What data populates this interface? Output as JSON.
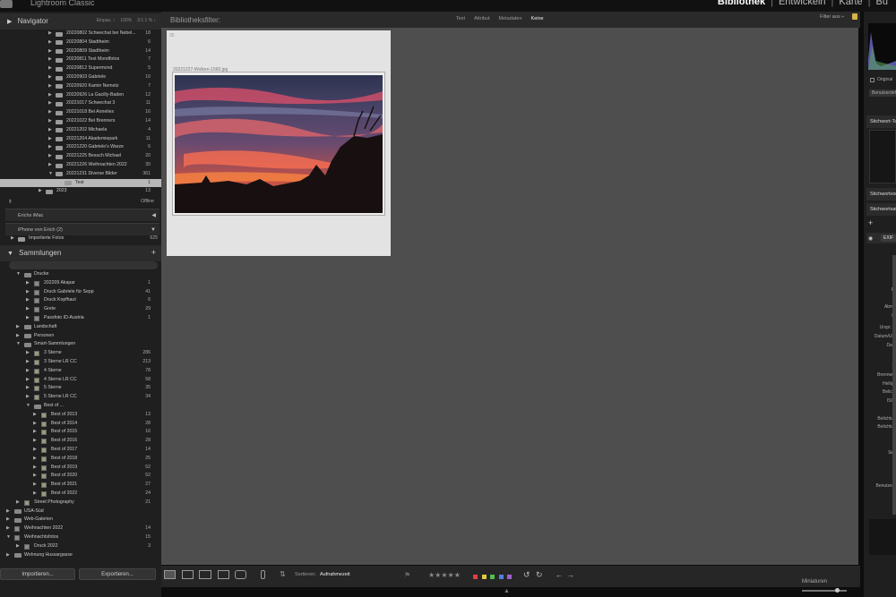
{
  "app": {
    "title": "Lightroom Classic"
  },
  "modules": {
    "items": [
      "Bibliothek",
      "|",
      "Entwickeln",
      "|",
      "Karte",
      "|",
      "Bu"
    ]
  },
  "navigator": {
    "title": "Navigator",
    "zoom": [
      "Einpas. ↕",
      "100%",
      "3:1:1 % ↕"
    ]
  },
  "folders": [
    {
      "label": "20220802 Schwechat bei Nebel...",
      "count": "18",
      "indent": 54,
      "tri": "▶"
    },
    {
      "label": "20220804 Stadtheim",
      "count": "6",
      "indent": 54,
      "tri": "▶"
    },
    {
      "label": "20220809 Stadtheim",
      "count": "14",
      "indent": 54,
      "tri": "▶"
    },
    {
      "label": "20220811 Test Mondfotos",
      "count": "7",
      "indent": 54,
      "tri": "▶"
    },
    {
      "label": "20220812 Supermond",
      "count": "5",
      "indent": 54,
      "tri": "▶"
    },
    {
      "label": "20220903 Gabriele",
      "count": "10",
      "indent": 54,
      "tri": "▶"
    },
    {
      "label": "20220920 Kamin Nemetz",
      "count": "7",
      "indent": 54,
      "tri": "▶"
    },
    {
      "label": "20220926 La Gacilly-Baden",
      "count": "12",
      "indent": 54,
      "tri": "▶"
    },
    {
      "label": "20221017 Schwechat 3",
      "count": "11",
      "indent": 54,
      "tri": "▶"
    },
    {
      "label": "20221018 Bei Annelies",
      "count": "16",
      "indent": 54,
      "tri": "▶"
    },
    {
      "label": "20221022 Bei Brenners",
      "count": "14",
      "indent": 54,
      "tri": "▶"
    },
    {
      "label": "20221202 Michaela",
      "count": "4",
      "indent": 54,
      "tri": "▶"
    },
    {
      "label": "20221204 Akademiepark",
      "count": "11",
      "indent": 54,
      "tri": "▶"
    },
    {
      "label": "20221220 Gabriele's Warze",
      "count": "6",
      "indent": 54,
      "tri": "▶"
    },
    {
      "label": "20221225 Besuch Michael",
      "count": "20",
      "indent": 54,
      "tri": "▶"
    },
    {
      "label": "20221226 Weihnachten 2022",
      "count": "30",
      "indent": 54,
      "tri": "▶"
    },
    {
      "label": "20221231 Diverse Bilder",
      "count": "361",
      "indent": 54,
      "tri": "▼"
    },
    {
      "label": "Test",
      "count": "1",
      "indent": 64,
      "tri": "",
      "selected": true
    },
    {
      "label": "2023",
      "count": "13",
      "indent": 43,
      "tri": "▶"
    }
  ],
  "sources": {
    "offline_label": "Offline",
    "erichs_imac": "Erichs iMac",
    "iphone": "iPhone von Erich (2)",
    "imported": {
      "label": "Importierte Fotos",
      "count": "625"
    }
  },
  "collections": {
    "title": "Sammlungen",
    "items": [
      {
        "label": "Drucke",
        "count": "",
        "indent": 18,
        "tri": "▼",
        "type": "set"
      },
      {
        "label": "202209 Akapar",
        "count": "1",
        "indent": 29,
        "tri": "▶",
        "type": "coll"
      },
      {
        "label": "Druck Gabriele für Sepp",
        "count": "41",
        "indent": 29,
        "tri": "▶",
        "type": "coll"
      },
      {
        "label": "Druck Kopfhaut",
        "count": "6",
        "indent": 29,
        "tri": "▶",
        "type": "coll"
      },
      {
        "label": "Grete",
        "count": "29",
        "indent": 29,
        "tri": "▶",
        "type": "coll"
      },
      {
        "label": "Passfoto ID-Austria",
        "count": "1",
        "indent": 29,
        "tri": "▶",
        "type": "coll"
      },
      {
        "label": "Landschaft",
        "count": "",
        "indent": 18,
        "tri": "▶",
        "type": "set"
      },
      {
        "label": "Personen",
        "count": "",
        "indent": 18,
        "tri": "▶",
        "type": "set"
      },
      {
        "label": "Smart-Sammlungen",
        "count": "",
        "indent": 18,
        "tri": "▼",
        "type": "set"
      },
      {
        "label": "3 Sterne",
        "count": "286",
        "indent": 29,
        "tri": "▶",
        "type": "smart"
      },
      {
        "label": "3 Sterne LR CC",
        "count": "213",
        "indent": 29,
        "tri": "▶",
        "type": "smart"
      },
      {
        "label": "4 Sterne",
        "count": "78",
        "indent": 29,
        "tri": "▶",
        "type": "smart"
      },
      {
        "label": "4 Sterne LR CC",
        "count": "58",
        "indent": 29,
        "tri": "▶",
        "type": "smart"
      },
      {
        "label": "5 Sterne",
        "count": "35",
        "indent": 29,
        "tri": "▶",
        "type": "smart"
      },
      {
        "label": "5 Sterne LR CC",
        "count": "34",
        "indent": 29,
        "tri": "▶",
        "type": "smart"
      },
      {
        "label": "Best of ...",
        "count": "",
        "indent": 29,
        "tri": "▼",
        "type": "set"
      },
      {
        "label": "Best of 2013",
        "count": "13",
        "indent": 37,
        "tri": "▶",
        "type": "smart"
      },
      {
        "label": "Best of 2014",
        "count": "28",
        "indent": 37,
        "tri": "▶",
        "type": "smart"
      },
      {
        "label": "Best of 2015",
        "count": "16",
        "indent": 37,
        "tri": "▶",
        "type": "smart"
      },
      {
        "label": "Best of 2016",
        "count": "28",
        "indent": 37,
        "tri": "▶",
        "type": "smart"
      },
      {
        "label": "Best of 2017",
        "count": "14",
        "indent": 37,
        "tri": "▶",
        "type": "smart"
      },
      {
        "label": "Best of 2018",
        "count": "25",
        "indent": 37,
        "tri": "▶",
        "type": "smart"
      },
      {
        "label": "Best of 2019",
        "count": "52",
        "indent": 37,
        "tri": "▶",
        "type": "smart"
      },
      {
        "label": "Best of 2020",
        "count": "52",
        "indent": 37,
        "tri": "▶",
        "type": "smart"
      },
      {
        "label": "Best of 2021",
        "count": "27",
        "indent": 37,
        "tri": "▶",
        "type": "smart"
      },
      {
        "label": "Best of 2022",
        "count": "24",
        "indent": 37,
        "tri": "▶",
        "type": "smart"
      },
      {
        "label": "Street Photography",
        "count": "21",
        "indent": 18,
        "tri": "▶",
        "type": "smart"
      },
      {
        "label": "USA-Süd",
        "count": "",
        "indent": 7,
        "tri": "▶",
        "type": "set"
      },
      {
        "label": "Web-Galerien",
        "count": "",
        "indent": 7,
        "tri": "▶",
        "type": "set"
      },
      {
        "label": "Weihnachten 2022",
        "count": "14",
        "indent": 7,
        "tri": "▶",
        "type": "coll"
      },
      {
        "label": "Weihnachtsfotos",
        "count": "15",
        "indent": 7,
        "tri": "▼",
        "type": "coll"
      },
      {
        "label": "Druck 2022",
        "count": "3",
        "indent": 18,
        "tri": "▶",
        "type": "coll"
      },
      {
        "label": "Wohnung Hussargasse",
        "count": "",
        "indent": 7,
        "tri": "▶",
        "type": "set"
      }
    ]
  },
  "buttons": {
    "import": "Importieren...",
    "export": "Exportieren..."
  },
  "filter": {
    "label": "Bibliotheksfilter:",
    "options": [
      "Text",
      "Attribut",
      "Metadaten",
      "Keine"
    ],
    "active": "Keine",
    "off": "Filter aus ÷"
  },
  "thumbnail": {
    "index": "35",
    "filename": "20221227-Wolken-1560.jpg"
  },
  "toolbar": {
    "sort_label": "Sortieren:",
    "sort_value": "Aufnahmezeit",
    "stars": "★★★★★",
    "colors": [
      "#e04040",
      "#e0c840",
      "#50c050",
      "#5080e0",
      "#a060d0"
    ],
    "thumb_label": "Miniaturen"
  },
  "right_panel": {
    "original": "Original",
    "user_btn": "Benutzerdefiniert",
    "keyword_tags": "Stichwort-Tags",
    "keyword_suggestions": "Stichwortvorschläge",
    "keyword_set": "Stichwortsatz",
    "exif": "EXIF",
    "meta_labels": [
      "D",
      "Fil",
      "A",
      "Abme",
      "Fr",
      "Urspr. D",
      "Datum/Uhr",
      "Datu",
      "B",
      "Bl",
      "Brennwei",
      "Helligk",
      "Belicht",
      "ISO-",
      "Belichtun",
      "Belichtun",
      "Seri",
      "Benutzerk"
    ]
  }
}
